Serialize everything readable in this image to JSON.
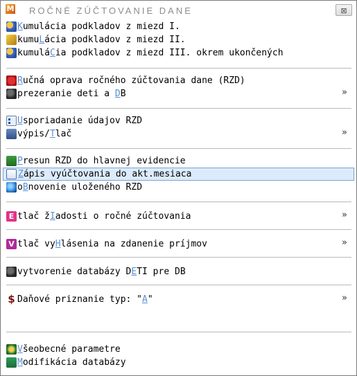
{
  "window": {
    "app_icon": "M",
    "title": "ROČNÉ ZÚČTOVANIE DANE",
    "close_label": "⊠"
  },
  "colors": {
    "selected_bg": "#dcebfc",
    "selected_border": "#7da2ce",
    "hotkey": "#5b8fd6"
  },
  "menu": {
    "i1": {
      "a": "",
      "k": "K",
      "b": "umulácia podkladov z miezd I."
    },
    "i2": {
      "a": "kumu",
      "k": "L",
      "b": "ácia podkladov z miezd II."
    },
    "i3": {
      "a": "kumulá",
      "k": "C",
      "b": "ia podkladov z miezd III. okrem ukončených"
    },
    "i4": {
      "a": "",
      "k": "R",
      "b": "učná oprava ročného zúčtovania dane (RZD)"
    },
    "i5": {
      "a": "prezeranie deti a ",
      "k": "D",
      "b": "B",
      "arrow": "»"
    },
    "i6": {
      "a": "",
      "k": "U",
      "b": "sporiadanie údajov RZD"
    },
    "i7": {
      "a": "výpis/",
      "k": "T",
      "b": "lač",
      "arrow": "»"
    },
    "i8": {
      "a": "",
      "k": "P",
      "b": "resun RZD do hlavnej evidencie"
    },
    "i9": {
      "a": "",
      "k": "Z",
      "b": "ápis vyúčtovania do akt.mesiaca"
    },
    "i10": {
      "a": "o",
      "k": "B",
      "b": "novenie uloženého RZD"
    },
    "i11": {
      "icon_letter": "E",
      "a": "tlač ž",
      "k": "I",
      "b": "adosti o ročné zúčtovania",
      "arrow": "»"
    },
    "i12": {
      "icon_letter": "V",
      "a": "tlač vy",
      "k": "H",
      "b": "lásenia na zdanenie príjmov",
      "arrow": "»"
    },
    "i13": {
      "a": "vytvorenie databázy D",
      "k": "E",
      "b": "TI pre DB"
    },
    "i14": {
      "icon_glyph": "$",
      "a": "Daňové priznanie typ: \"",
      "k": "A",
      "b": "\"",
      "arrow": "»"
    },
    "i15": {
      "a": "",
      "k": "V",
      "b": "šeobecné parametre"
    },
    "i16": {
      "a": "",
      "k": "M",
      "b": "odifikácia databázy"
    }
  }
}
